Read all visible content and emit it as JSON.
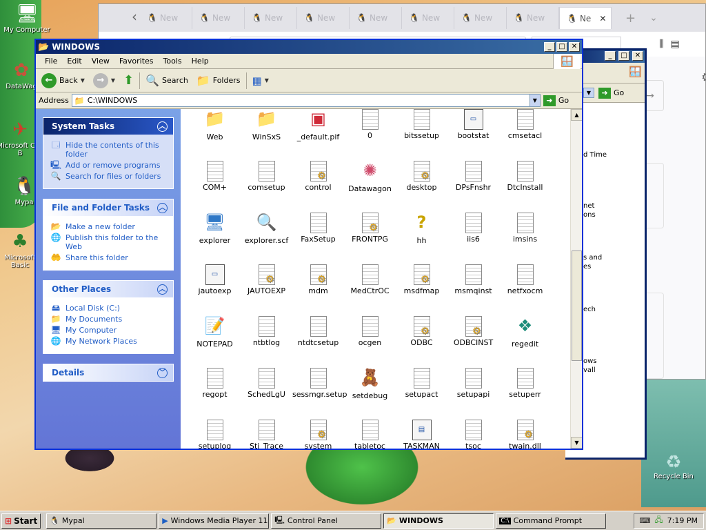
{
  "desktop": {
    "icons": [
      {
        "label": "My Computer",
        "icon": "computer-icon"
      },
      {
        "label": "DataWag",
        "icon": "datawagon-icon"
      },
      {
        "label": "Microsoft Call B",
        "icon": "app-shortcut-icon"
      },
      {
        "label": "Mypa",
        "icon": "mypal-icon"
      },
      {
        "label": "Microsoft Basic",
        "icon": "app-shortcut-icon"
      }
    ],
    "recycle_bin": "Recycle Bin"
  },
  "browser": {
    "tabs": [
      "New",
      "New",
      "New",
      "New",
      "New",
      "New",
      "New",
      "New",
      "Ne"
    ],
    "close": "✕",
    "new_tab": "+",
    "tab_menu": "⌄"
  },
  "background_window": {
    "go_label": "Go",
    "items": [
      "d Time",
      "net",
      "ons",
      "s and",
      "es",
      "ech",
      "ows",
      "vall"
    ]
  },
  "window": {
    "title": "WINDOWS",
    "controls": {
      "minimize": "_",
      "maximize": "□",
      "close": "✕"
    },
    "menu": [
      "File",
      "Edit",
      "View",
      "Favorites",
      "Tools",
      "Help"
    ],
    "toolbar": {
      "back": "Back",
      "search": "Search",
      "folders": "Folders"
    },
    "address": {
      "label": "Address",
      "value": "C:\\WINDOWS",
      "go": "Go"
    },
    "panels": {
      "system_tasks": {
        "title": "System Tasks",
        "items": [
          "Hide the contents of this folder",
          "Add or remove programs",
          "Search for files or folders"
        ]
      },
      "file_folder_tasks": {
        "title": "File and Folder Tasks",
        "items": [
          "Make a new folder",
          "Publish this folder to the Web",
          "Share this folder"
        ]
      },
      "other_places": {
        "title": "Other Places",
        "items": [
          "Local Disk (C:)",
          "My Documents",
          "My Computer",
          "My Network Places"
        ]
      },
      "details": {
        "title": "Details"
      }
    },
    "files": [
      {
        "name": "Web",
        "type": "folder"
      },
      {
        "name": "WinSxS",
        "type": "folder"
      },
      {
        "name": "_default.pif",
        "type": "msdos"
      },
      {
        "name": "0",
        "type": "doc"
      },
      {
        "name": "bitssetup",
        "type": "doc"
      },
      {
        "name": "bootstat",
        "type": "app"
      },
      {
        "name": "cmsetacl",
        "type": "doc"
      },
      {
        "name": "COM+",
        "type": "doc"
      },
      {
        "name": "comsetup",
        "type": "doc"
      },
      {
        "name": "control",
        "type": "cfg"
      },
      {
        "name": "Datawagon",
        "type": "star"
      },
      {
        "name": "desktop",
        "type": "cfg"
      },
      {
        "name": "DPsFnshr",
        "type": "doc"
      },
      {
        "name": "DtcInstall",
        "type": "doc"
      },
      {
        "name": "explorer",
        "type": "screen"
      },
      {
        "name": "explorer.scf",
        "type": "search"
      },
      {
        "name": "FaxSetup",
        "type": "doc"
      },
      {
        "name": "FRONTPG",
        "type": "cfg"
      },
      {
        "name": "hh",
        "type": "question"
      },
      {
        "name": "iis6",
        "type": "doc"
      },
      {
        "name": "imsins",
        "type": "doc"
      },
      {
        "name": "jautoexp",
        "type": "app"
      },
      {
        "name": "JAUTOEXP",
        "type": "cfg"
      },
      {
        "name": "mdm",
        "type": "cfg"
      },
      {
        "name": "MedCtrOC",
        "type": "doc"
      },
      {
        "name": "msdfmap",
        "type": "cfg"
      },
      {
        "name": "msmqinst",
        "type": "doc"
      },
      {
        "name": "netfxocm",
        "type": "doc"
      },
      {
        "name": "NOTEPAD",
        "type": "note"
      },
      {
        "name": "ntbtlog",
        "type": "doc"
      },
      {
        "name": "ntdtcsetup",
        "type": "doc"
      },
      {
        "name": "ocgen",
        "type": "doc"
      },
      {
        "name": "ODBC",
        "type": "cfg"
      },
      {
        "name": "ODBCINST",
        "type": "cfg"
      },
      {
        "name": "regedit",
        "type": "cube"
      },
      {
        "name": "regopt",
        "type": "doc"
      },
      {
        "name": "SchedLgU",
        "type": "doc"
      },
      {
        "name": "sessmgr.setup",
        "type": "doc"
      },
      {
        "name": "setdebug",
        "type": "bear"
      },
      {
        "name": "setupact",
        "type": "doc"
      },
      {
        "name": "setupapi",
        "type": "doc"
      },
      {
        "name": "setuperr",
        "type": "doc"
      },
      {
        "name": "setuplog",
        "type": "doc"
      },
      {
        "name": "Sti_Trace",
        "type": "doc"
      },
      {
        "name": "system",
        "type": "cfg"
      },
      {
        "name": "tabletoc",
        "type": "doc"
      },
      {
        "name": "TASKMAN",
        "type": "window"
      },
      {
        "name": "tsoc",
        "type": "doc"
      },
      {
        "name": "twain.dll",
        "type": "dll"
      }
    ]
  },
  "taskbar": {
    "start": "Start",
    "tasks": [
      {
        "label": "Mypal",
        "pressed": false
      },
      {
        "label": "Windows Media Player 11",
        "pressed": false
      },
      {
        "label": "Control Panel",
        "pressed": false
      },
      {
        "label": "WINDOWS",
        "pressed": true
      },
      {
        "label": "Command Prompt",
        "pressed": false
      }
    ],
    "clock": "7:19 PM"
  },
  "colors": {
    "title_blue": "#0a246a",
    "xp_face": "#ece9d8",
    "link_blue": "#215dc6"
  }
}
